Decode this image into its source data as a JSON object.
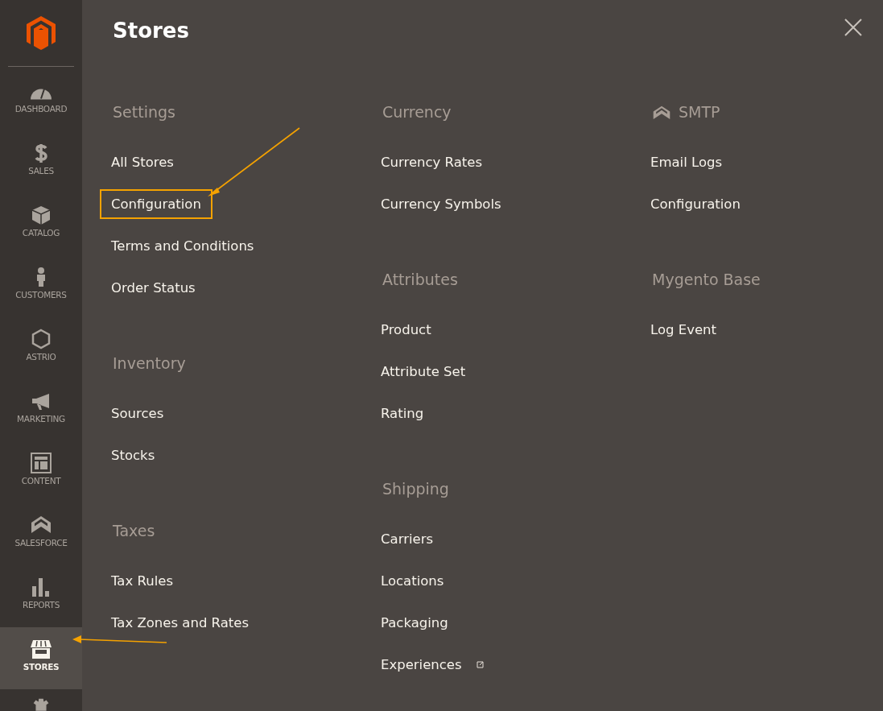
{
  "sidebar": {
    "items": [
      {
        "label": "DASHBOARD",
        "selected": false,
        "highlighted": false
      },
      {
        "label": "SALES",
        "selected": false,
        "highlighted": false
      },
      {
        "label": "CATALOG",
        "selected": false,
        "highlighted": false
      },
      {
        "label": "CUSTOMERS",
        "selected": false,
        "highlighted": false
      },
      {
        "label": "ASTRIO",
        "selected": false,
        "highlighted": false
      },
      {
        "label": "MARKETING",
        "selected": false,
        "highlighted": false
      },
      {
        "label": "CONTENT",
        "selected": false,
        "highlighted": false
      },
      {
        "label": "SALESFORCE",
        "selected": false,
        "highlighted": false
      },
      {
        "label": "REPORTS",
        "selected": false,
        "highlighted": false
      },
      {
        "label": "STORES",
        "selected": true,
        "highlighted": true
      }
    ]
  },
  "panel": {
    "title": "Stores",
    "columns": [
      [
        {
          "title": "Settings",
          "items": [
            {
              "label": "All Stores",
              "highlighted": false
            },
            {
              "label": "Configuration",
              "highlighted": true
            },
            {
              "label": "Terms and Conditions",
              "highlighted": false
            },
            {
              "label": "Order Status",
              "highlighted": false
            }
          ]
        },
        {
          "title": "Inventory",
          "items": [
            {
              "label": "Sources",
              "highlighted": false
            },
            {
              "label": "Stocks",
              "highlighted": false
            }
          ]
        },
        {
          "title": "Taxes",
          "items": [
            {
              "label": "Tax Rules",
              "highlighted": false
            },
            {
              "label": "Tax Zones and Rates",
              "highlighted": false
            }
          ]
        }
      ],
      [
        {
          "title": "Currency",
          "items": [
            {
              "label": "Currency Rates",
              "highlighted": false
            },
            {
              "label": "Currency Symbols",
              "highlighted": false
            }
          ]
        },
        {
          "title": "Attributes",
          "items": [
            {
              "label": "Product",
              "highlighted": false
            },
            {
              "label": "Attribute Set",
              "highlighted": false
            },
            {
              "label": "Rating",
              "highlighted": false
            }
          ]
        },
        {
          "title": "Shipping",
          "items": [
            {
              "label": "Carriers",
              "highlighted": false
            },
            {
              "label": "Locations",
              "highlighted": false
            },
            {
              "label": "Packaging",
              "highlighted": false
            },
            {
              "label": "Experiences",
              "highlighted": false,
              "external": true
            }
          ]
        }
      ],
      [
        {
          "title": "SMTP",
          "icon": true,
          "items": [
            {
              "label": "Email Logs",
              "highlighted": false
            },
            {
              "label": "Configuration",
              "highlighted": false
            }
          ]
        },
        {
          "title": "Mygento Base",
          "items": [
            {
              "label": "Log Event",
              "highlighted": false
            }
          ]
        }
      ]
    ]
  }
}
